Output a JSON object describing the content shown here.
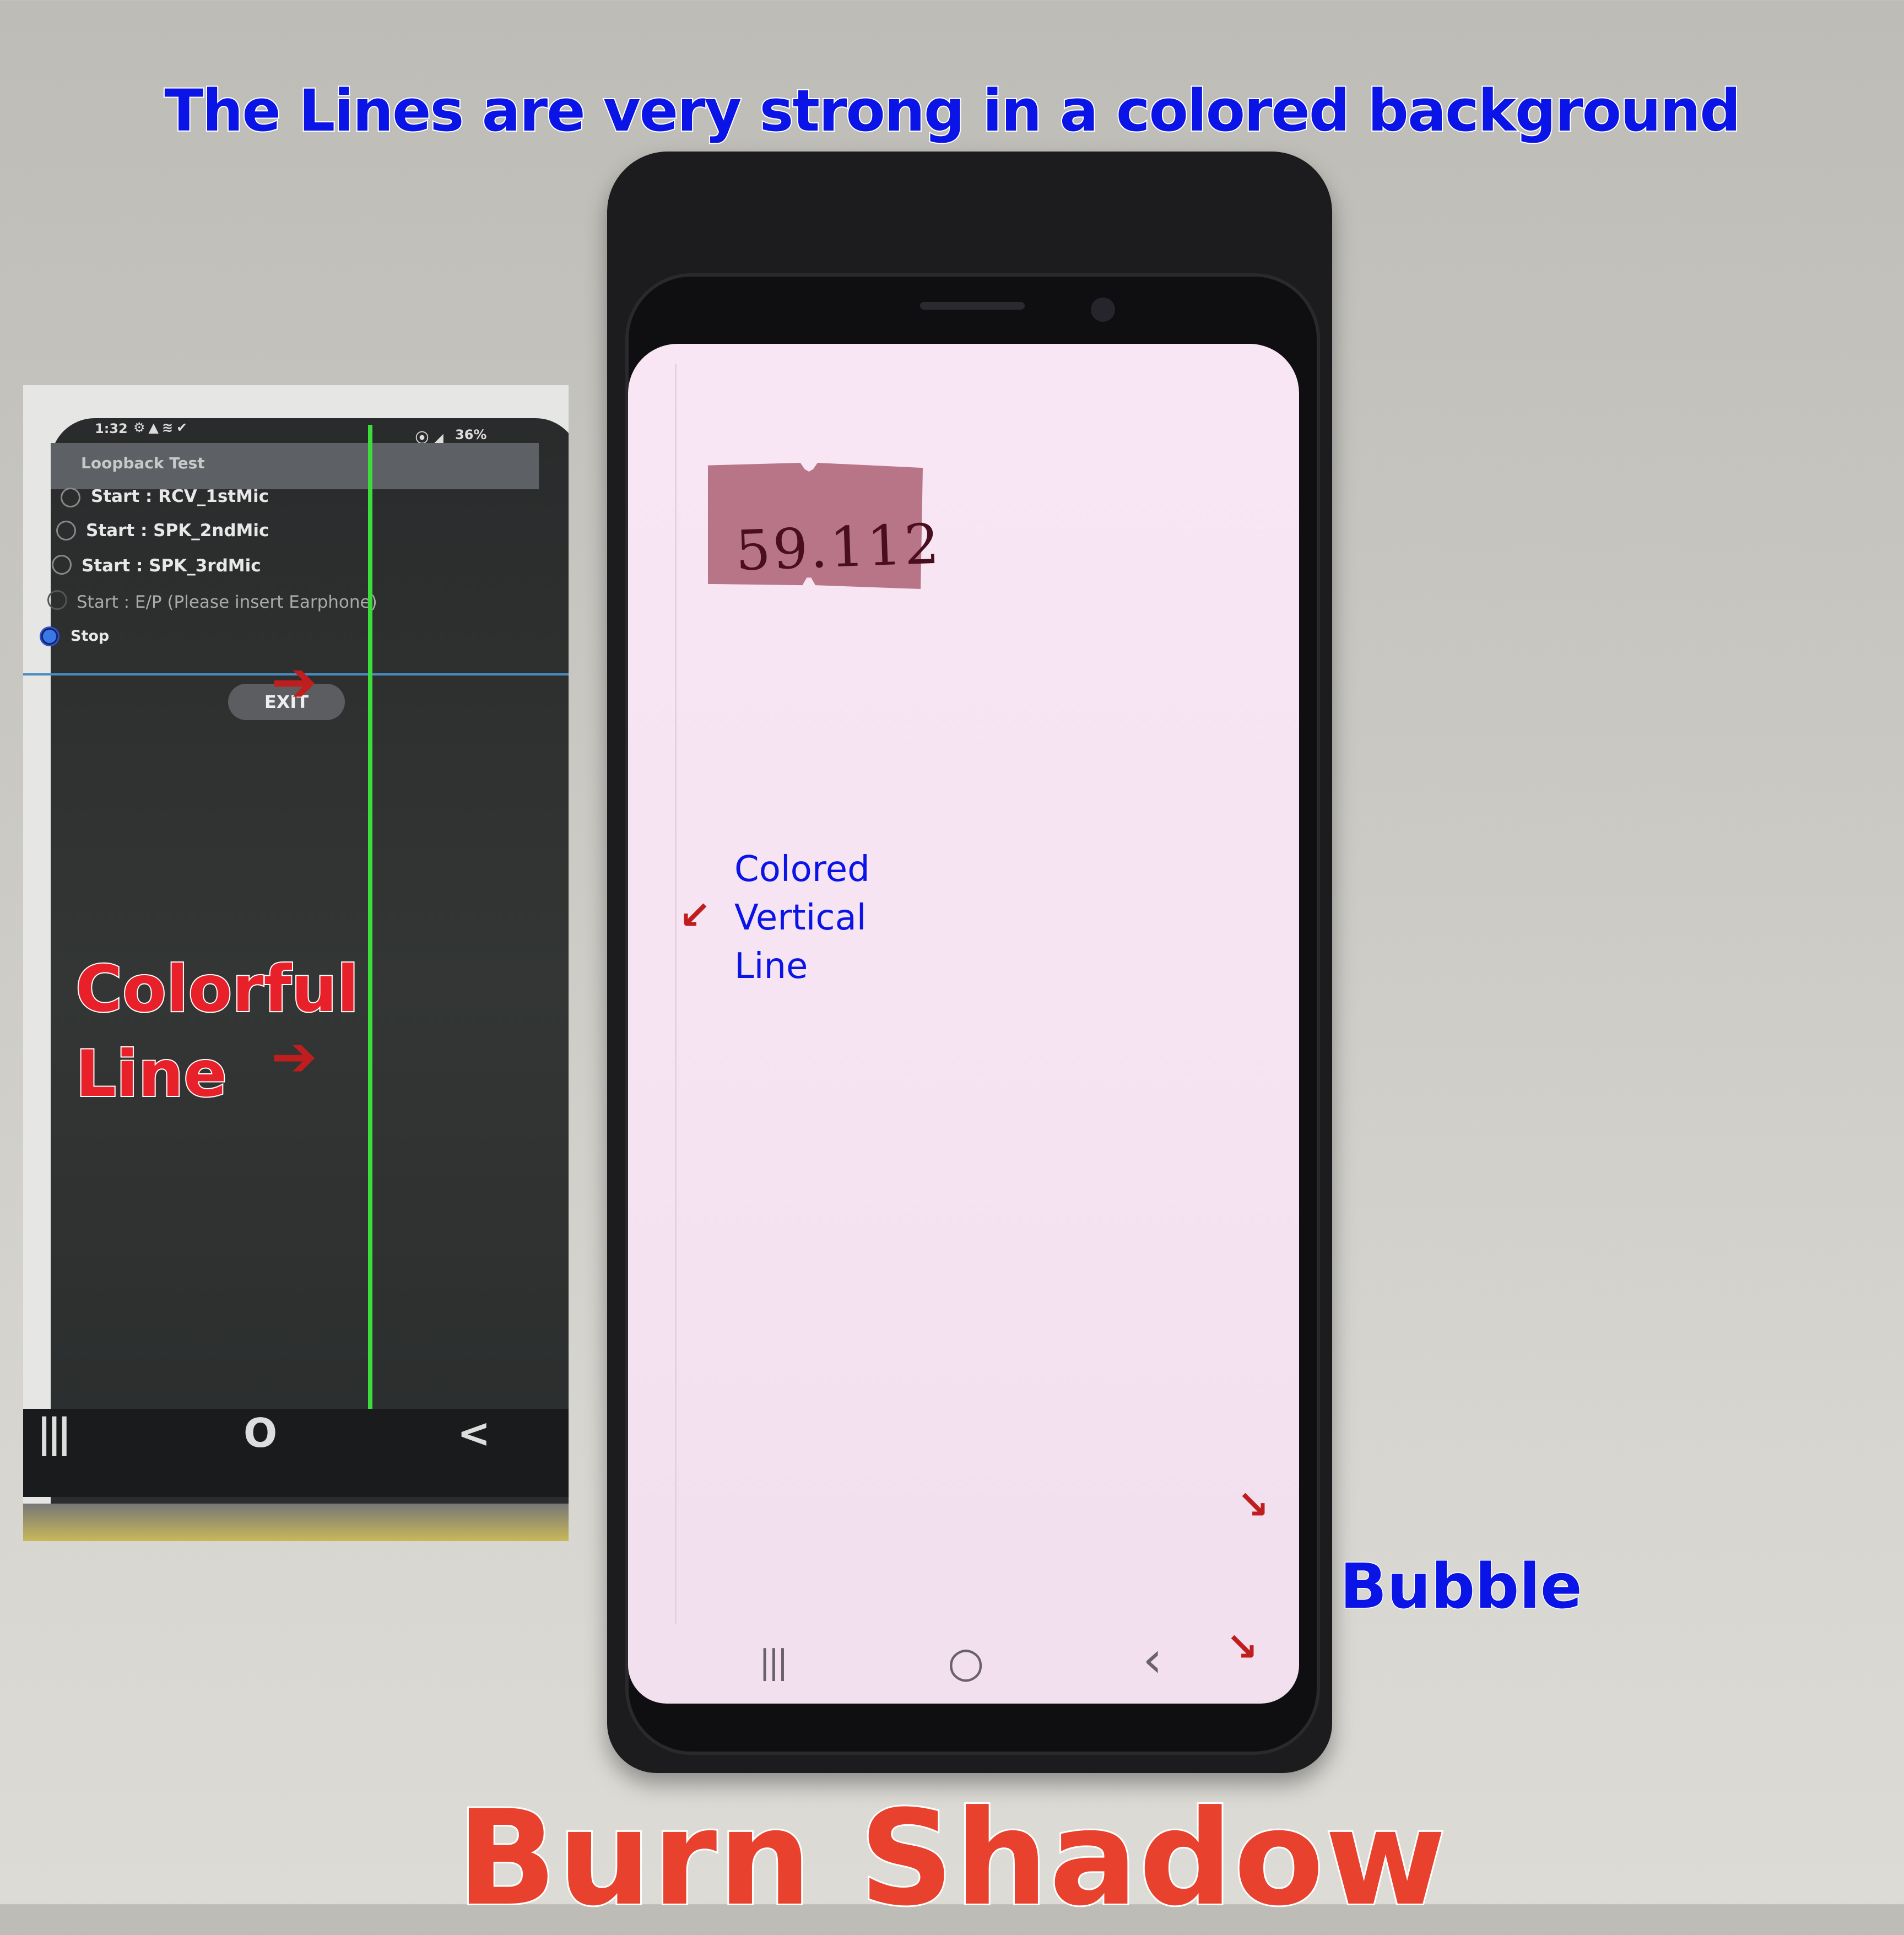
{
  "headline": "The Lines are very strong in a colored background",
  "footer_title": "Burn Shadow",
  "annotations": {
    "colored_vertical_line": [
      "Colored",
      "Vertical",
      "Line"
    ],
    "bubble": "Bubble",
    "colorful_line": [
      "Colorful",
      "Line"
    ]
  },
  "phone_screen": {
    "sticker_text": "59.112",
    "nav": {
      "recents": "|||",
      "home": "○",
      "back": "‹"
    },
    "background_color": "#f7e4f1"
  },
  "inset": {
    "status_time": "1:32",
    "status_battery": "36%",
    "app_title": "Loopback Test",
    "options": [
      {
        "label": "Start : RCV_1stMic",
        "selected": false
      },
      {
        "label": "Start : SPK_2ndMic",
        "selected": false
      },
      {
        "label": "Start : SPK_3rdMic",
        "selected": false
      },
      {
        "label": "Start : E/P (Please insert Earphone)",
        "selected": false,
        "disabled": true
      },
      {
        "label": "Stop",
        "selected": true
      }
    ],
    "exit_label": "EXIT",
    "nav": {
      "recents": "|||",
      "home": "O",
      "back": "<"
    },
    "line_color": "#3cdc3c"
  },
  "colors": {
    "headline": "#0a14e6",
    "footer": "#e8412e",
    "arrow": "#c01e1e"
  }
}
